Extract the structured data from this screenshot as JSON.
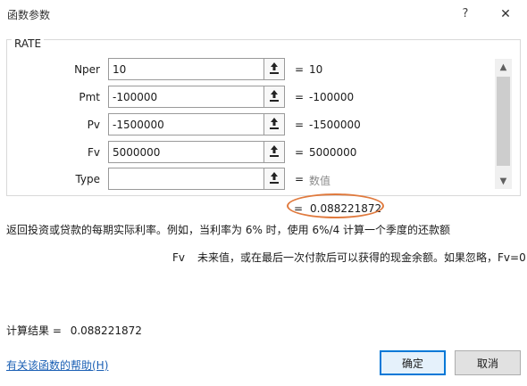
{
  "window": {
    "title": "函数参数",
    "help_glyph": "?",
    "close_glyph": "✕"
  },
  "function_name": "RATE",
  "arguments": [
    {
      "label": "Nper",
      "value": "10",
      "result": "10",
      "hint": false
    },
    {
      "label": "Pmt",
      "value": "-100000",
      "result": "-100000",
      "hint": false
    },
    {
      "label": "Pv",
      "value": "-1500000",
      "result": "-1500000",
      "hint": false
    },
    {
      "label": "Fv",
      "value": "5000000",
      "result": "5000000",
      "hint": false
    },
    {
      "label": "Type",
      "value": "",
      "result": "数值",
      "hint": true
    }
  ],
  "equals_sign": "=",
  "formula_result": "0.088221872",
  "description": "返回投资或贷款的每期实际利率。例如，当利率为 6% 时，使用 6%/4 计算一个季度的还款额",
  "param_help": {
    "name": "Fv",
    "text": "未来值，或在最后一次付款后可以获得的现金余额。如果忽略，Fv=0"
  },
  "calc_result": {
    "label": "计算结果 =",
    "value": "0.088221872"
  },
  "help_link": "有关该函数的帮助(H)",
  "buttons": {
    "ok": "确定",
    "cancel": "取消"
  },
  "icons": {
    "ref_button": "collapse-dialog-icon",
    "scroll_up": "scroll-up-icon",
    "scroll_down": "scroll-down-icon"
  },
  "colors": {
    "highlight": "#e07a3e",
    "link": "#1a5fb4",
    "ok_border": "#0078d7"
  }
}
